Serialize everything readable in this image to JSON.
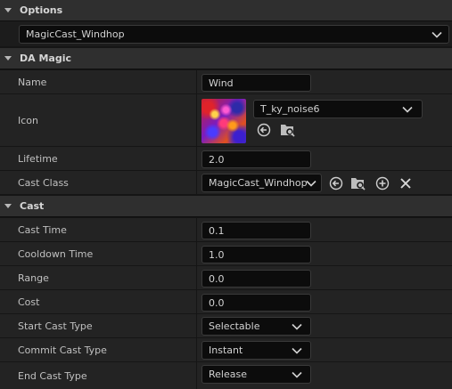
{
  "options": {
    "header": "Options",
    "selected": "MagicCast_Windhop"
  },
  "da_magic": {
    "header": "DA Magic",
    "name_label": "Name",
    "name_value": "Wind",
    "icon_label": "Icon",
    "icon_asset": "T_ky_noise6",
    "lifetime_label": "Lifetime",
    "lifetime_value": "2.0",
    "cast_class_label": "Cast Class",
    "cast_class_value": "MagicCast_Windhop"
  },
  "cast": {
    "header": "Cast",
    "cast_time_label": "Cast Time",
    "cast_time_value": "0.1",
    "cooldown_label": "Cooldown Time",
    "cooldown_value": "1.0",
    "range_label": "Range",
    "range_value": "0.0",
    "cost_label": "Cost",
    "cost_value": "0.0",
    "start_cast_label": "Start Cast Type",
    "start_cast_value": "Selectable",
    "commit_cast_label": "Commit Cast Type",
    "commit_cast_value": "Instant",
    "end_cast_label": "End Cast Type",
    "end_cast_value": "Release"
  },
  "icons": [
    "chevron-down-icon",
    "use-selected-arrow-icon",
    "browse-folder-icon",
    "add-icon",
    "clear-icon"
  ]
}
